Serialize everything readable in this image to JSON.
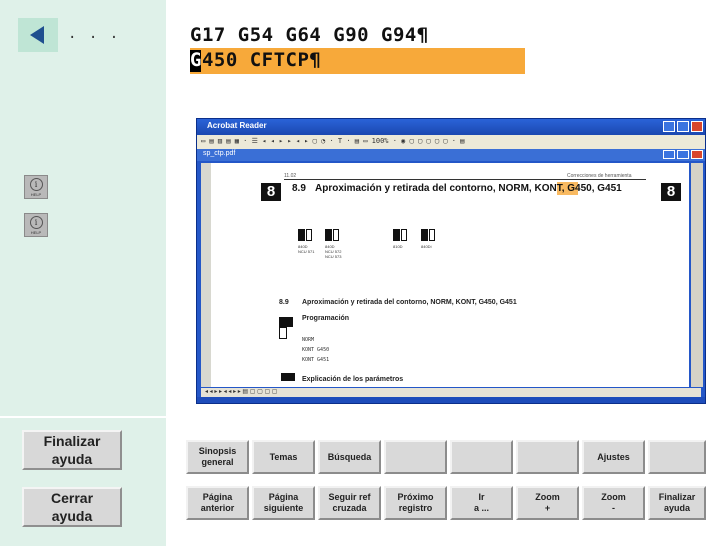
{
  "left": {
    "back_dots": ". . .",
    "help_label": "HELP",
    "finalizar": "Finalizar\nayuda",
    "cerrar": "Cerrar\nayuda"
  },
  "code": {
    "line1": "G17 G54 G64 G90 G94¶",
    "line2": "G450 CFTCP¶",
    "cursor_char": "G"
  },
  "acrobat": {
    "title": "Acrobat Reader",
    "toolbar": "▭ ▤ ▥  ▤ ▦ · ☰  ◂ ◂ ▸ ▸  ◂ ▸  ▢ ◔ · T · ▤  ▭ 100% · ◉  ▢ ▢ ▢ ▢  ▢ · ▤",
    "doc_title": "sp_ctp.pdf",
    "status": "◂ ◂  ▸ ▸   ◂ ◂  ▸ ▸   ▤ ▢ ▢ ▢ ▢",
    "page_num": "8",
    "header_left": "11.02",
    "header_right": "Correcciones de herramienta",
    "section_num": "8.9",
    "section_title": "Aproximación y retirada del contorno, NORM, KONT, G450, G451",
    "ctrl1_lbl": "840D\nNCU 571",
    "ctrl2_lbl": "840D\nNCU 572\nNCU 573",
    "ctrl3_lbl": "810D",
    "ctrl4_lbl": "840Di",
    "section_num2": "8.9",
    "section_title2": "Aproximación y retirada del contorno, NORM, KONT, G450, G451",
    "prog_title": "Programación",
    "prog1": "NORM",
    "prog2": "KONT G450",
    "prog3": "KONT G451",
    "cut_text": "Explicación de los parámetros"
  },
  "softkeys_top": [
    {
      "label": "Sinopsis\ngeneral"
    },
    {
      "label": "Temas"
    },
    {
      "label": "Búsqueda"
    },
    {
      "label": ""
    },
    {
      "label": ""
    },
    {
      "label": ""
    },
    {
      "label": "Ajustes"
    },
    {
      "label": ""
    }
  ],
  "softkeys_bottom": [
    {
      "label": "Página\nanterior"
    },
    {
      "label": "Página\nsiguiente"
    },
    {
      "label": "Seguir ref\ncruzada"
    },
    {
      "label": "Próximo\nregistro"
    },
    {
      "label": "Ir\na ..."
    },
    {
      "label": "Zoom\n+"
    },
    {
      "label": "Zoom\n-"
    },
    {
      "label": "Finalizar\nayuda"
    }
  ],
  "colors": {
    "panel": "#dff1e9",
    "highlight": "#f7a93a",
    "window_blue": "#2457c8"
  }
}
